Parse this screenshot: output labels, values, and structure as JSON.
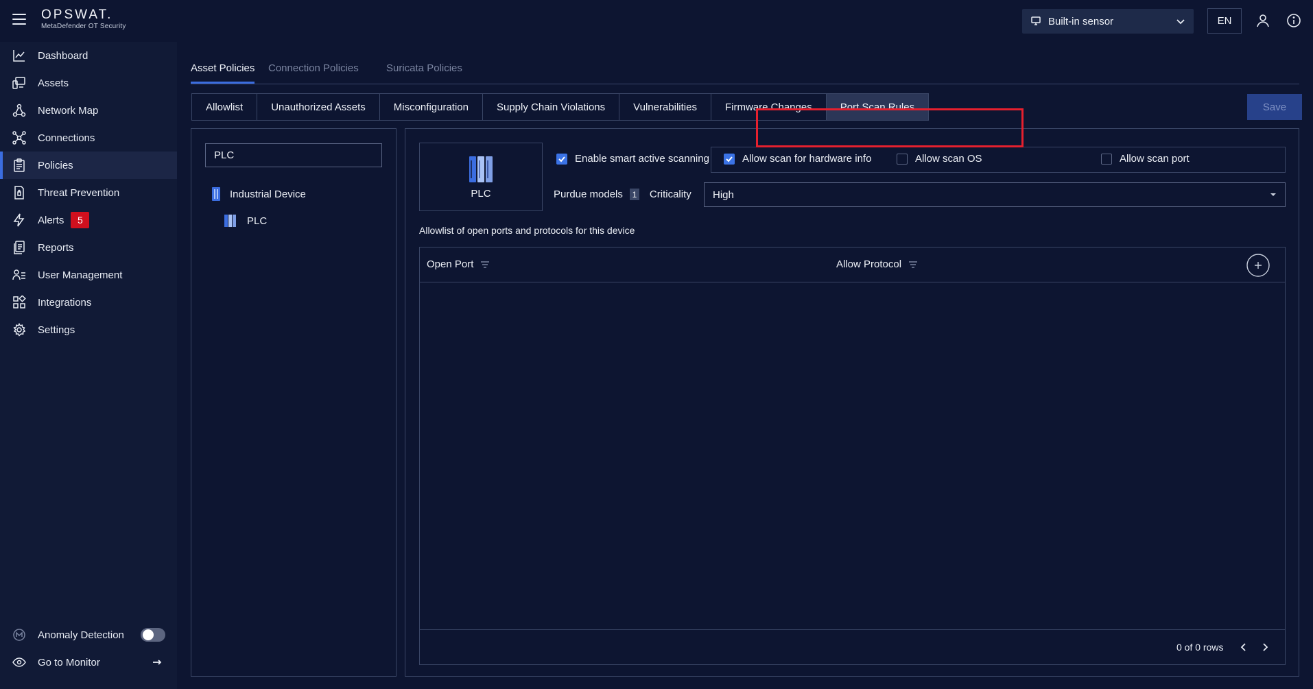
{
  "brand": {
    "name": "OPSWAT.",
    "product": "MetaDefender OT Security"
  },
  "header": {
    "sensor": "Built-in sensor",
    "language": "EN"
  },
  "sidebar": {
    "items": [
      {
        "label": "Dashboard",
        "icon": "chart-line-icon"
      },
      {
        "label": "Assets",
        "icon": "devices-icon"
      },
      {
        "label": "Network Map",
        "icon": "network-icon"
      },
      {
        "label": "Connections",
        "icon": "connections-icon"
      },
      {
        "label": "Policies",
        "icon": "clipboard-icon"
      },
      {
        "label": "Threat Prevention",
        "icon": "shield-file-icon"
      },
      {
        "label": "Alerts",
        "icon": "lightning-icon",
        "badge": "5"
      },
      {
        "label": "Reports",
        "icon": "reports-icon"
      },
      {
        "label": "User Management",
        "icon": "user-list-icon"
      },
      {
        "label": "Integrations",
        "icon": "integrations-icon"
      },
      {
        "label": "Settings",
        "icon": "gear-icon"
      }
    ],
    "bottom": {
      "anomaly": "Anomaly Detection",
      "monitor": "Go to Monitor"
    }
  },
  "tabs": [
    "Asset Policies",
    "Connection Policies",
    "Suricata Policies"
  ],
  "subtabs": [
    "Allowlist",
    "Unauthorized Assets",
    "Misconfiguration",
    "Supply Chain Violations",
    "Vulnerabilities",
    "Firmware Changes",
    "Port Scan Rules"
  ],
  "save_label": "Save",
  "search": {
    "value": "PLC"
  },
  "tree": {
    "parent": "Industrial Device",
    "child": "PLC"
  },
  "device": {
    "name": "PLC"
  },
  "options": {
    "smart": "Enable smart active scanning",
    "hardware": "Allow scan for hardware info",
    "os": "Allow scan OS",
    "port": "Allow scan port"
  },
  "purdue": {
    "label": "Purdue models",
    "count": "1"
  },
  "criticality": {
    "label": "Criticality",
    "value": "High"
  },
  "allowlist_title": "Allowlist of open ports and protocols for this device",
  "table": {
    "col_port": "Open Port",
    "col_protocol": "Allow Protocol",
    "rows_text": "0 of 0 rows"
  },
  "colors": {
    "accent": "#3b6de0",
    "alert": "#d0101e",
    "highlight": "#e5202e"
  }
}
